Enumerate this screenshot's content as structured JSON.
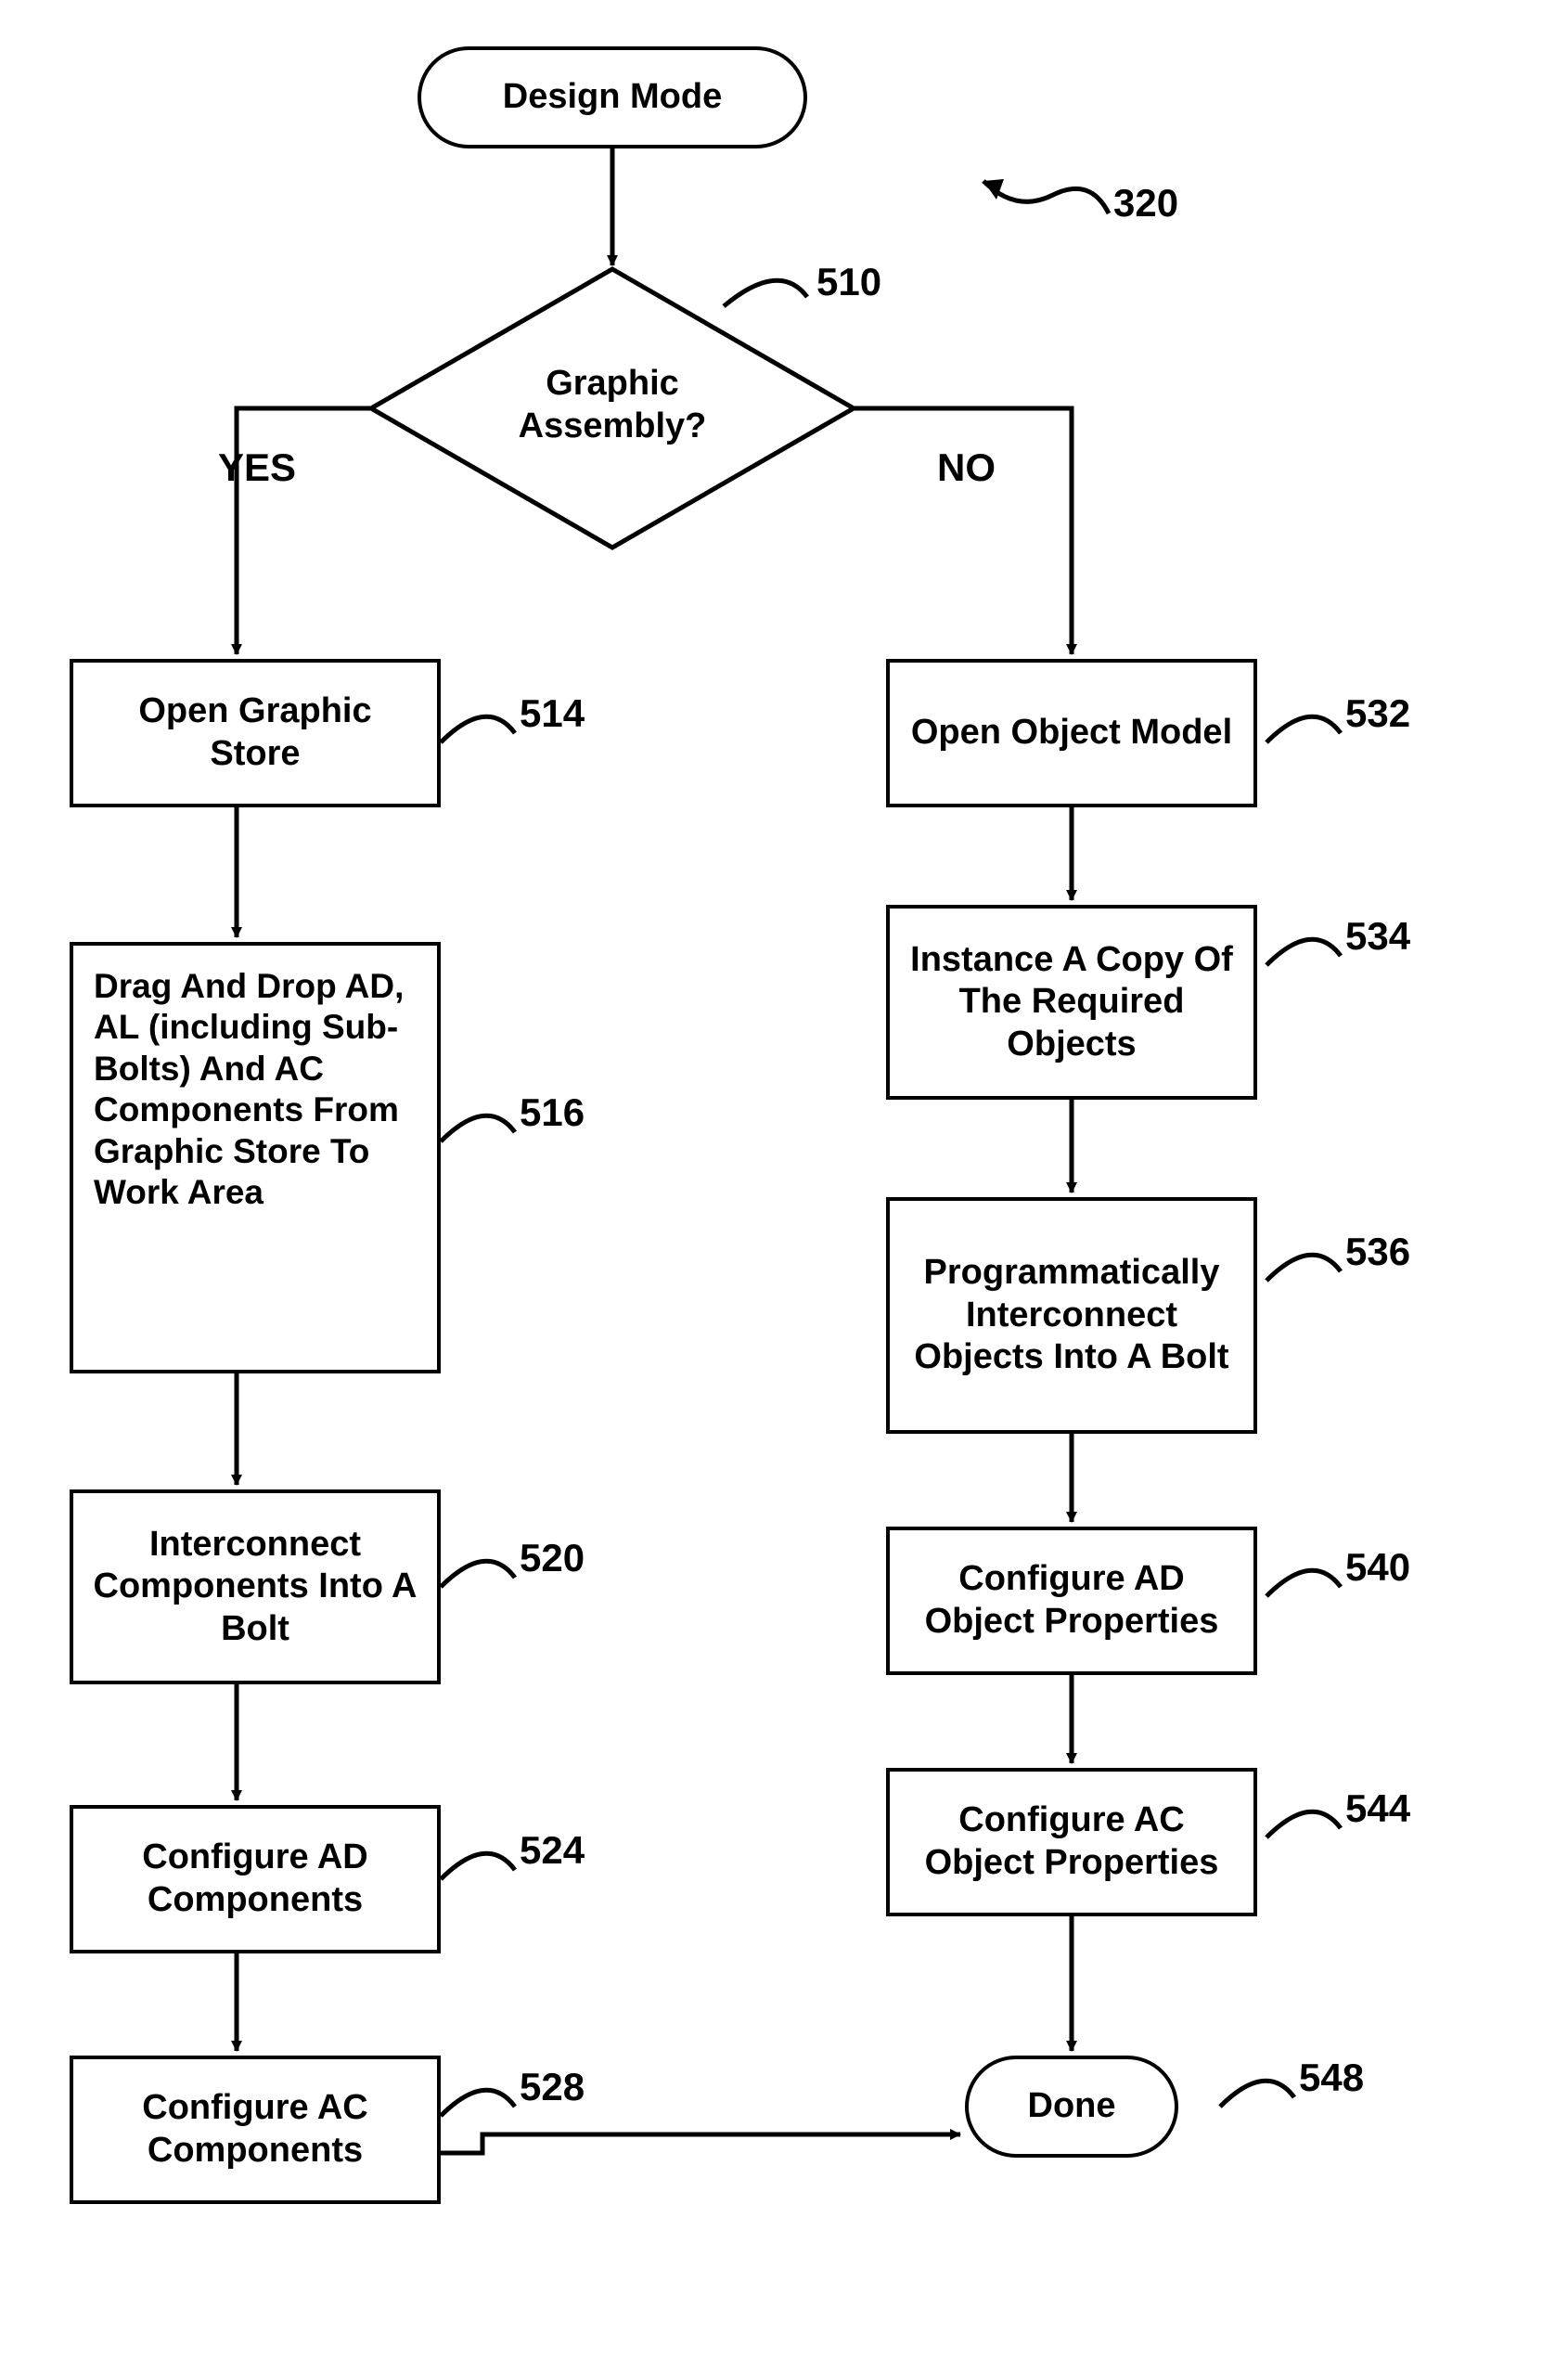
{
  "chart_data": {
    "type": "flowchart",
    "title": "",
    "nodes": [
      {
        "id": "start",
        "shape": "terminator",
        "text": "Design Mode",
        "ref": ""
      },
      {
        "id": "decision",
        "shape": "decision",
        "text": "Graphic Assembly?",
        "ref": "510"
      },
      {
        "id": "yes1",
        "shape": "process",
        "text": "Open Graphic Store",
        "ref": "514"
      },
      {
        "id": "yes2",
        "shape": "process",
        "text": "Drag And Drop AD, AL (including Sub-Bolts) And AC Components From Graphic Store To Work Area",
        "ref": "516"
      },
      {
        "id": "yes3",
        "shape": "process",
        "text": "Interconnect Components Into A Bolt",
        "ref": "520"
      },
      {
        "id": "yes4",
        "shape": "process",
        "text": "Configure AD Components",
        "ref": "524"
      },
      {
        "id": "yes5",
        "shape": "process",
        "text": "Configure AC Components",
        "ref": "528"
      },
      {
        "id": "no1",
        "shape": "process",
        "text": "Open Object Model",
        "ref": "532"
      },
      {
        "id": "no2",
        "shape": "process",
        "text": "Instance A Copy Of The Required Objects",
        "ref": "534"
      },
      {
        "id": "no3",
        "shape": "process",
        "text": "Programmatically Interconnect Objects Into A Bolt",
        "ref": "536"
      },
      {
        "id": "no4",
        "shape": "process",
        "text": "Configure AD Object Properties",
        "ref": "540"
      },
      {
        "id": "no5",
        "shape": "process",
        "text": "Configure AC Object Properties",
        "ref": "544"
      },
      {
        "id": "done",
        "shape": "terminator",
        "text": "Done",
        "ref": "548"
      }
    ],
    "edges": [
      {
        "from": "start",
        "to": "decision",
        "label": ""
      },
      {
        "from": "decision",
        "to": "yes1",
        "label": "YES"
      },
      {
        "from": "decision",
        "to": "no1",
        "label": "NO"
      },
      {
        "from": "yes1",
        "to": "yes2",
        "label": ""
      },
      {
        "from": "yes2",
        "to": "yes3",
        "label": ""
      },
      {
        "from": "yes3",
        "to": "yes4",
        "label": ""
      },
      {
        "from": "yes4",
        "to": "yes5",
        "label": ""
      },
      {
        "from": "no1",
        "to": "no2",
        "label": ""
      },
      {
        "from": "no2",
        "to": "no3",
        "label": ""
      },
      {
        "from": "no3",
        "to": "no4",
        "label": ""
      },
      {
        "from": "no4",
        "to": "no5",
        "label": ""
      },
      {
        "from": "no5",
        "to": "done",
        "label": ""
      },
      {
        "from": "yes5",
        "to": "done",
        "label": ""
      }
    ],
    "figure_ref": "320",
    "branch_labels": {
      "yes": "YES",
      "no": "NO"
    }
  },
  "nodes": {
    "start": "Design Mode",
    "decision_l1": "Graphic",
    "decision_l2": "Assembly?",
    "yes1": "Open Graphic Store",
    "yes2": "Drag And Drop AD, AL (including Sub-Bolts) And AC Components From Graphic Store To Work Area",
    "yes3": "Interconnect Components Into A Bolt",
    "yes4": "Configure AD Components",
    "yes5": "Configure AC Components",
    "no1": "Open Object Model",
    "no2": "Instance A Copy Of The Required Objects",
    "no3": "Programmatically Interconnect Objects Into A Bolt",
    "no4": "Configure AD Object Properties",
    "no5": "Configure AC Object Properties",
    "done": "Done"
  },
  "refs": {
    "figure": "320",
    "decision": "510",
    "yes1": "514",
    "yes2": "516",
    "yes3": "520",
    "yes4": "524",
    "yes5": "528",
    "no1": "532",
    "no2": "534",
    "no3": "536",
    "no4": "540",
    "no5": "544",
    "done": "548"
  },
  "branches": {
    "yes": "YES",
    "no": "NO"
  }
}
